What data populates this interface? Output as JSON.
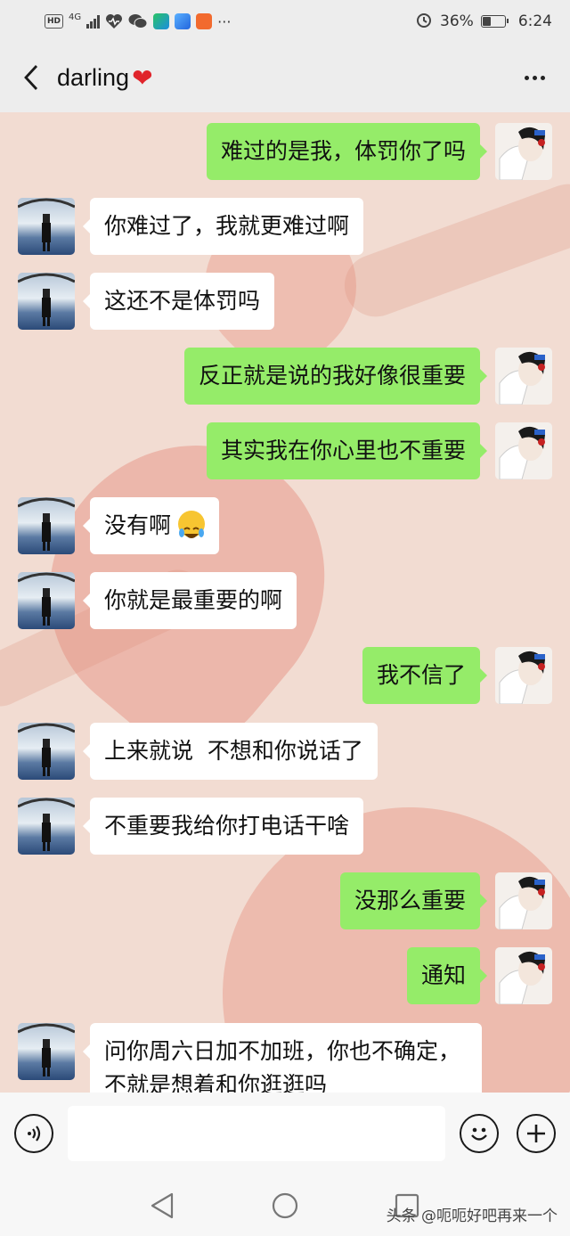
{
  "status_bar": {
    "hd": "HD",
    "network": "4G",
    "battery_text": "36%",
    "battery_level": 0.36,
    "time": "6:24",
    "more": "···"
  },
  "header": {
    "title": "darling",
    "title_emoji": "❤"
  },
  "messages": [
    {
      "side": "out",
      "text": "难过的是我，体罚你了吗"
    },
    {
      "side": "in",
      "text": "你难过了，我就更难过啊"
    },
    {
      "side": "in",
      "text": "这还不是体罚吗"
    },
    {
      "side": "out",
      "text": "反正就是说的我好像很重要"
    },
    {
      "side": "out",
      "text": "其实我在你心里也不重要"
    },
    {
      "side": "in",
      "text": "没有啊"
    },
    {
      "side": "in",
      "text": "你就是最重要的啊"
    },
    {
      "side": "out",
      "text": "我不信了"
    },
    {
      "side": "in",
      "text": "上来就说  不想和你说话了"
    },
    {
      "side": "in",
      "text": "不重要我给你打电话干啥"
    },
    {
      "side": "out",
      "text": "没那么重要"
    },
    {
      "side": "out",
      "text": "通知"
    },
    {
      "side": "in",
      "text": "问你周六日加不加班，你也不确定，不就是想着和你逛逛吗"
    }
  ],
  "input": {
    "value": "",
    "placeholder": ""
  },
  "watermark": "头条 @呃呃好吧再来一个",
  "colors": {
    "outgoing_bubble": "#95ec69",
    "incoming_bubble": "#ffffff",
    "chat_background": "#f2dcd2"
  },
  "icons": [
    "back-arrow-icon",
    "more-icon",
    "voice-icon",
    "emoji-icon",
    "plus-icon",
    "nav-back-icon",
    "nav-home-icon",
    "nav-recent-icon"
  ]
}
